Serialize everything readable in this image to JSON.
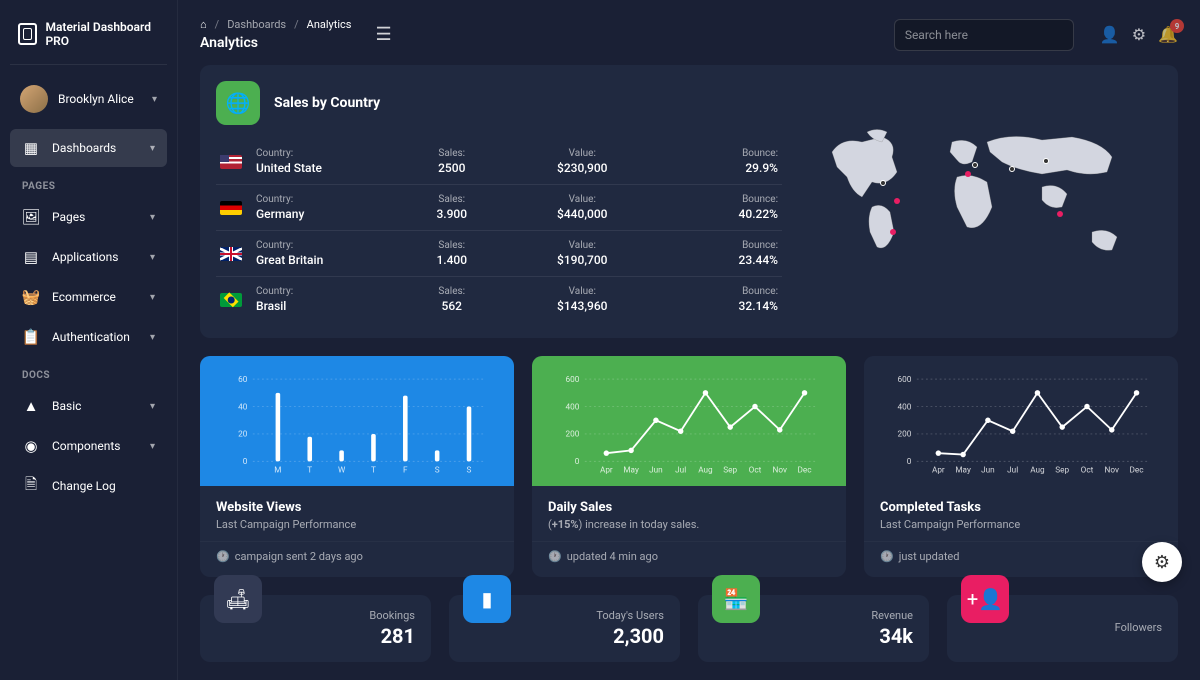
{
  "brand": "Material Dashboard PRO",
  "user": {
    "name": "Brooklyn Alice"
  },
  "nav": {
    "dashboards": "Dashboards",
    "sections": {
      "pages": "PAGES",
      "docs": "DOCS"
    },
    "items": {
      "pages": "Pages",
      "applications": "Applications",
      "ecommerce": "Ecommerce",
      "authentication": "Authentication",
      "basic": "Basic",
      "components": "Components",
      "changelog": "Change Log"
    }
  },
  "breadcrumb": {
    "level1": "Dashboards",
    "level2": "Analytics",
    "page_title": "Analytics"
  },
  "search": {
    "placeholder": "Search here"
  },
  "notifications": {
    "count": "9"
  },
  "sales": {
    "title": "Sales by Country",
    "headers": {
      "country": "Country:",
      "sales": "Sales:",
      "value": "Value:",
      "bounce": "Bounce:"
    },
    "rows": [
      {
        "flag": "us",
        "country": "United State",
        "sales": "2500",
        "value": "$230,900",
        "bounce": "29.9%"
      },
      {
        "flag": "de",
        "country": "Germany",
        "sales": "3.900",
        "value": "$440,000",
        "bounce": "40.22%"
      },
      {
        "flag": "gb",
        "country": "Great Britain",
        "sales": "1.400",
        "value": "$190,700",
        "bounce": "23.44%"
      },
      {
        "flag": "br",
        "country": "Brasil",
        "sales": "562",
        "value": "$143,960",
        "bounce": "32.14%"
      }
    ]
  },
  "charts": [
    {
      "title": "Website Views",
      "subtitle": "Last Campaign Performance",
      "footer": "campaign sent 2 days ago"
    },
    {
      "title": "Daily Sales",
      "subtitle_prefix": "(",
      "subtitle_bold": "+15%",
      "subtitle_rest": ") increase in today sales.",
      "footer": "updated 4 min ago"
    },
    {
      "title": "Completed Tasks",
      "subtitle": "Last Campaign Performance",
      "footer": "just updated"
    }
  ],
  "chart_data": [
    {
      "type": "bar",
      "categories": [
        "M",
        "T",
        "W",
        "T",
        "F",
        "S",
        "S"
      ],
      "values": [
        50,
        18,
        8,
        20,
        48,
        8,
        40
      ],
      "ylim": [
        0,
        60
      ],
      "yticks": [
        0,
        20,
        40,
        60
      ]
    },
    {
      "type": "line",
      "categories": [
        "Apr",
        "May",
        "Jun",
        "Jul",
        "Aug",
        "Sep",
        "Oct",
        "Nov",
        "Dec"
      ],
      "values": [
        60,
        80,
        300,
        220,
        500,
        250,
        400,
        230,
        500
      ],
      "ylim": [
        0,
        600
      ],
      "yticks": [
        0,
        200,
        400,
        600
      ]
    },
    {
      "type": "line",
      "categories": [
        "Apr",
        "May",
        "Jun",
        "Jul",
        "Aug",
        "Sep",
        "Oct",
        "Nov",
        "Dec"
      ],
      "values": [
        60,
        50,
        300,
        220,
        500,
        250,
        400,
        230,
        500
      ],
      "ylim": [
        0,
        600
      ],
      "yticks": [
        0,
        200,
        400,
        600
      ]
    }
  ],
  "stats": [
    {
      "label": "Bookings",
      "value": "281",
      "color": "dark",
      "icon": "couch"
    },
    {
      "label": "Today's Users",
      "value": "2,300",
      "color": "blue",
      "icon": "bar"
    },
    {
      "label": "Revenue",
      "value": "34k",
      "color": "green",
      "icon": "store"
    },
    {
      "label": "Followers",
      "value": "",
      "color": "pink",
      "icon": "person-plus"
    }
  ]
}
